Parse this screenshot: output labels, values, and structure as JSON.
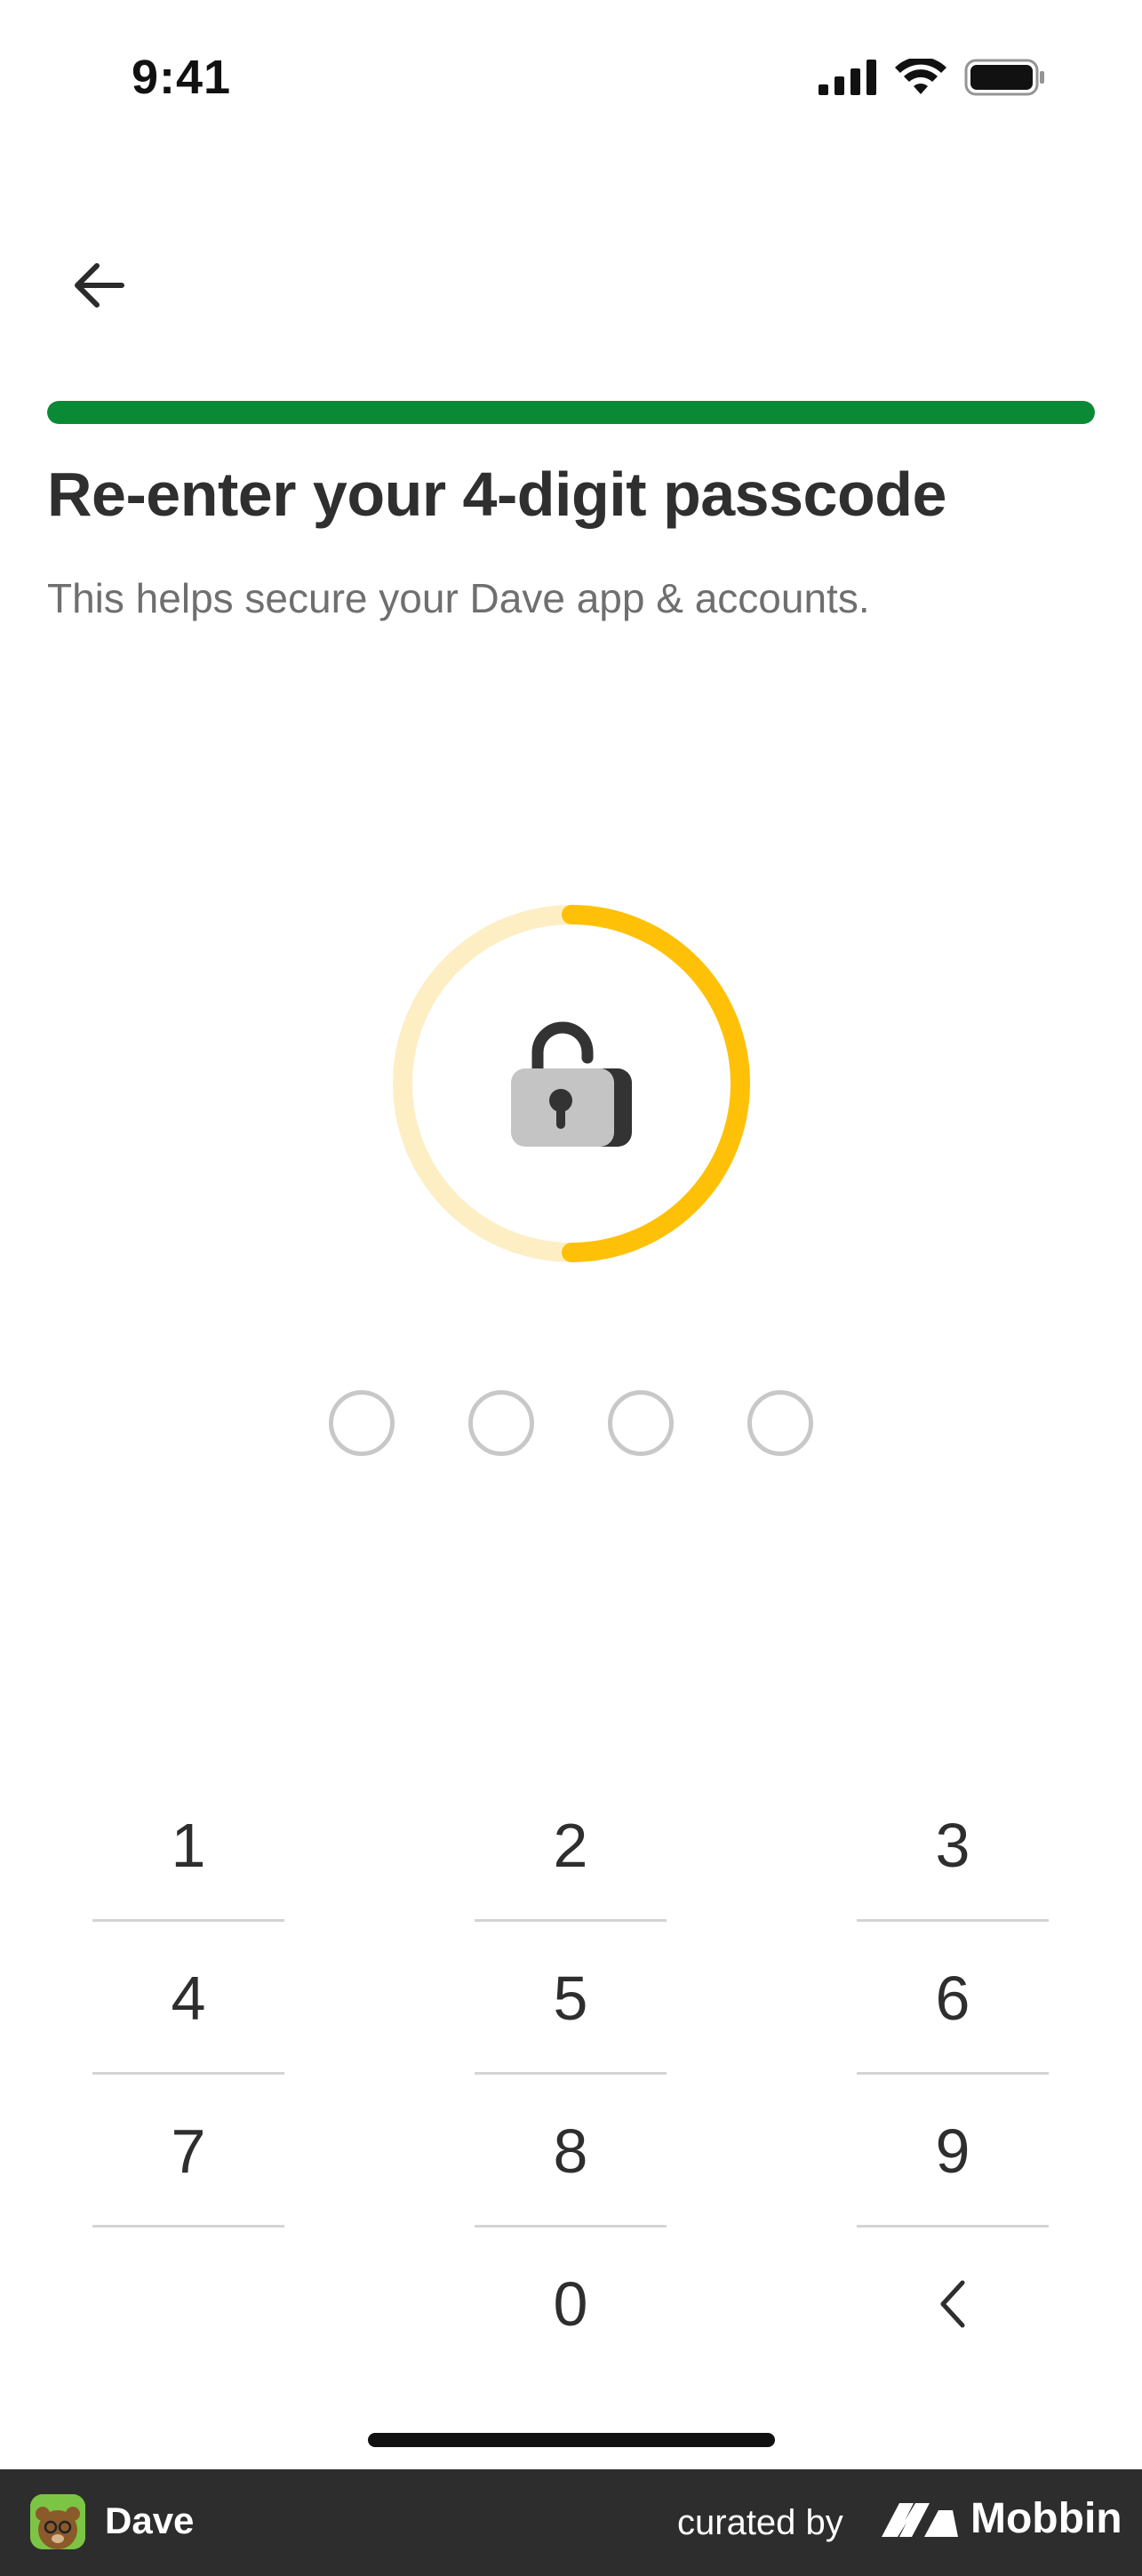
{
  "status_bar": {
    "time": "9:41",
    "icons": [
      "signal-icon",
      "wifi-icon",
      "battery-icon"
    ]
  },
  "header": {
    "back_icon": "arrow-left-icon",
    "progress": 1.0,
    "progress_color": "#0a8a35"
  },
  "main": {
    "title": "Re-enter your 4-digit passcode",
    "subtitle": "This helps secure your Dave app & accounts.",
    "lock_icon": "unlocked-padlock-icon",
    "ring_progress": 0.5,
    "ring_color": "#ffc107",
    "ring_track_color": "#fdeec4",
    "pin_length": 4,
    "pin_filled": 0
  },
  "keypad": {
    "keys": [
      "1",
      "2",
      "3",
      "4",
      "5",
      "6",
      "7",
      "8",
      "9",
      "",
      "0",
      "backspace"
    ],
    "labels": {
      "k1": "1",
      "k2": "2",
      "k3": "3",
      "k4": "4",
      "k5": "5",
      "k6": "6",
      "k7": "7",
      "k8": "8",
      "k9": "9",
      "k0": "0"
    },
    "backspace_icon": "chevron-left-icon"
  },
  "footer": {
    "app_name": "Dave",
    "curated_by": "curated by",
    "brand": "Mobbin",
    "bar_color": "#2d2d2d"
  }
}
